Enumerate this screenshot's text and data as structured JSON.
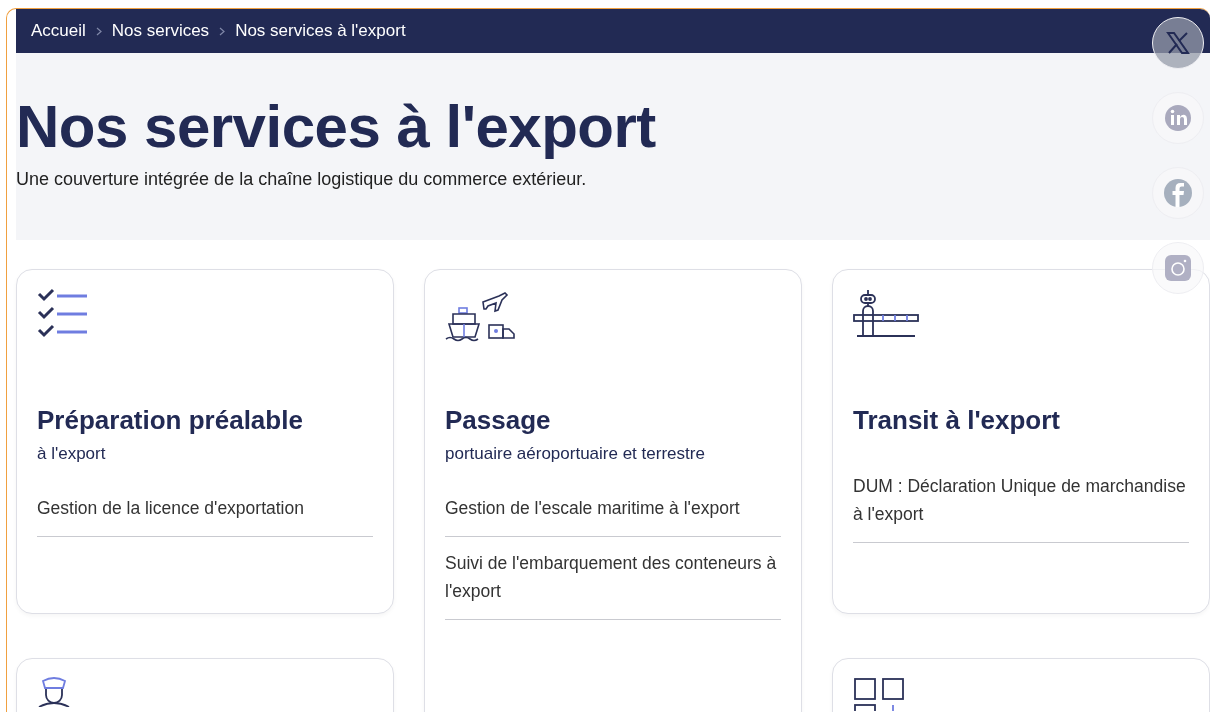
{
  "breadcrumb": [
    {
      "label": "Accueil"
    },
    {
      "label": "Nos services"
    },
    {
      "label": "Nos services à l'export"
    }
  ],
  "hero": {
    "title": "Nos services à l'export",
    "subtitle": "Une couverture intégrée de la chaîne logistique du commerce extérieur."
  },
  "social": [
    {
      "kind": "x",
      "highlighted": true
    },
    {
      "kind": "linkedin",
      "highlighted": false
    },
    {
      "kind": "facebook",
      "highlighted": false
    },
    {
      "kind": "instagram",
      "highlighted": false
    }
  ],
  "columns": [
    [
      {
        "kind": "checklist",
        "title": "Préparation préalable",
        "subtitle": "à l'export",
        "items": [
          "Gestion de la licence d'exportation"
        ]
      },
      {
        "kind": "officer"
      }
    ],
    [
      {
        "kind": "transport",
        "title": "Passage",
        "subtitle": "portuaire aéroportuaire et terrestre",
        "items": [
          "Gestion de l'escale maritime à l'export",
          "Suivi de l'embarquement des conteneurs à l'export"
        ]
      }
    ],
    [
      {
        "kind": "barrier",
        "title": "Transit à l'export",
        "items": [
          "DUM : Déclaration Unique de marchandise à l'export"
        ]
      },
      {
        "kind": "grid"
      }
    ]
  ]
}
